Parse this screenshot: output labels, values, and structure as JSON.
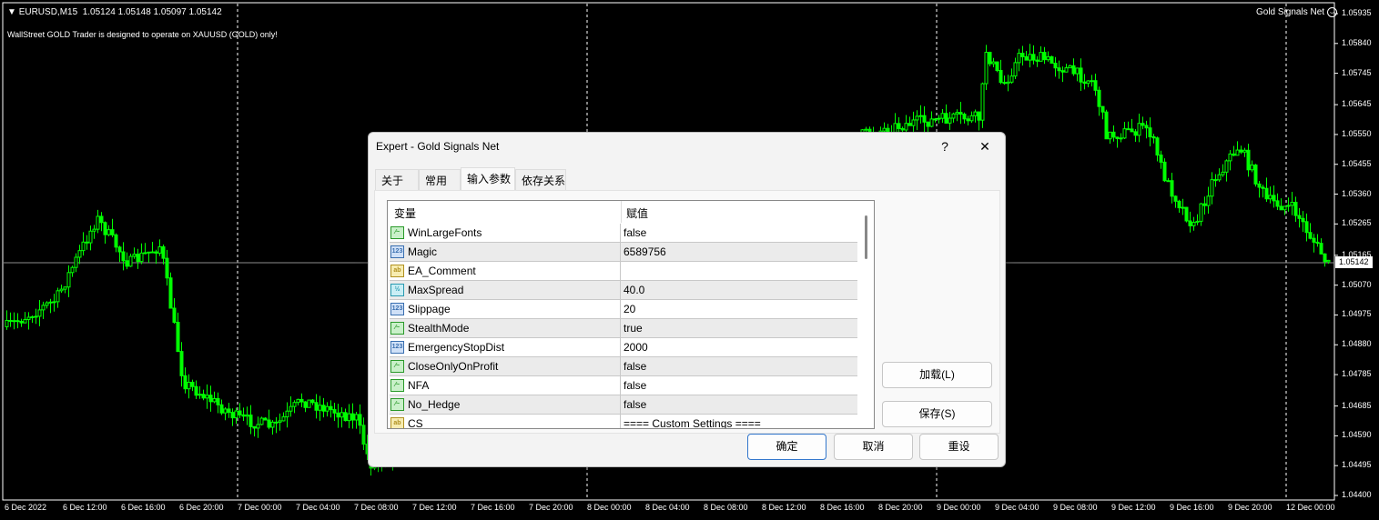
{
  "chart_header": {
    "symbol": "EURUSD,M15",
    "ohlc": "1.05124 1.05148 1.05097 1.05142",
    "message": "WallStreet GOLD Trader is designed to operate on XAUUSD (GOLD) only!",
    "ea_name": "Gold Signals Net",
    "ea_icon": "smiley-icon"
  },
  "price_axis": [
    "1.05935",
    "1.05840",
    "1.05745",
    "1.05645",
    "1.05550",
    "1.05455",
    "1.05360",
    "1.05265",
    "1.05165",
    "1.05070",
    "1.04975",
    "1.04880",
    "1.04785",
    "1.04685",
    "1.04590",
    "1.04495",
    "1.04400"
  ],
  "current_price": "1.05142",
  "time_axis": [
    "6 Dec 2022",
    "6 Dec 12:00",
    "6 Dec 16:00",
    "6 Dec 20:00",
    "7 Dec 00:00",
    "7 Dec 04:00",
    "7 Dec 08:00",
    "7 Dec 12:00",
    "7 Dec 16:00",
    "7 Dec 20:00",
    "8 Dec 00:00",
    "8 Dec 04:00",
    "8 Dec 08:00",
    "8 Dec 12:00",
    "8 Dec 16:00",
    "8 Dec 20:00",
    "9 Dec 00:00",
    "9 Dec 04:00",
    "9 Dec 08:00",
    "9 Dec 12:00",
    "9 Dec 16:00",
    "9 Dec 20:00",
    "12 Dec 00:00"
  ],
  "colors": {
    "candle": "#00ff00",
    "background": "#000000",
    "grid": "#ffffff"
  },
  "dialog": {
    "title": "Expert - Gold Signals Net",
    "help": "?",
    "close": "✕",
    "tabs": [
      "关于",
      "常用",
      "输入参数",
      "依存关系"
    ],
    "active_tab": "输入参数",
    "columns": [
      "变量",
      "赋值"
    ],
    "params": [
      {
        "name": "WinLargeFonts",
        "value": "false",
        "type": "bool"
      },
      {
        "name": "Magic",
        "value": "6589756",
        "type": "int"
      },
      {
        "name": "EA_Comment",
        "value": "",
        "type": "string"
      },
      {
        "name": "MaxSpread",
        "value": "40.0",
        "type": "double"
      },
      {
        "name": "Slippage",
        "value": "20",
        "type": "int"
      },
      {
        "name": "StealthMode",
        "value": "true",
        "type": "bool"
      },
      {
        "name": "EmergencyStopDist",
        "value": "2000",
        "type": "int"
      },
      {
        "name": "CloseOnlyOnProfit",
        "value": "false",
        "type": "bool"
      },
      {
        "name": "NFA",
        "value": "false",
        "type": "bool"
      },
      {
        "name": "No_Hedge",
        "value": "false",
        "type": "bool"
      },
      {
        "name": "CS",
        "value": "==== Custom Settings ====",
        "type": "string"
      }
    ],
    "load": "加载(L)",
    "save": "保存(S)",
    "ok": "确定",
    "cancel": "取消",
    "reset": "重设"
  }
}
